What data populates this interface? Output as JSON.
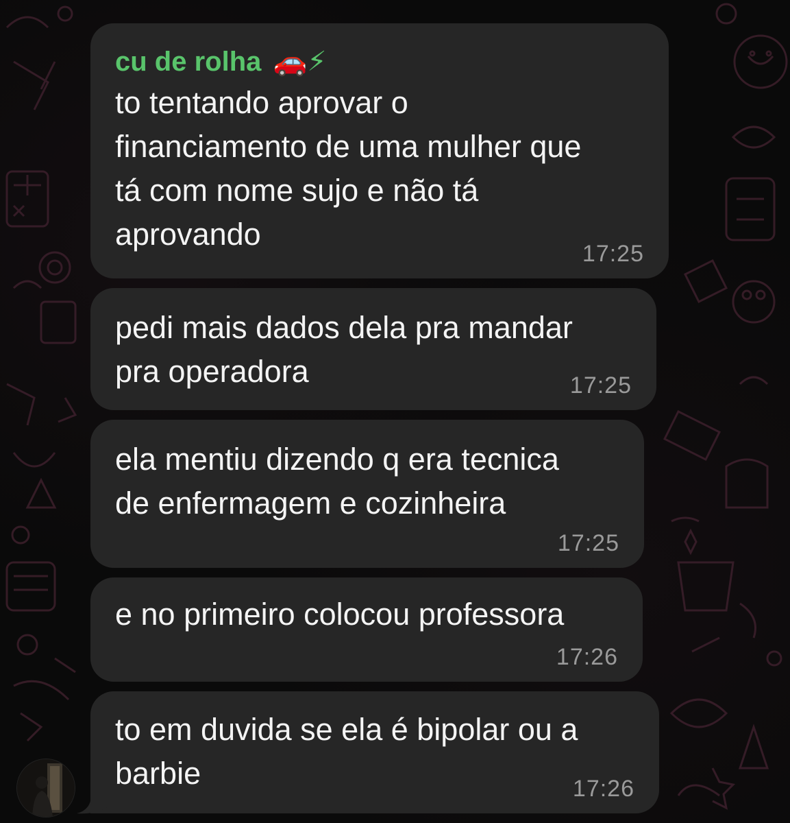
{
  "chat": {
    "sender": {
      "name": "cu de rolha",
      "emoji": "🚗⚡",
      "color": "#59c46b"
    },
    "messages": [
      {
        "text": "to tentando aprovar o\nfinanciamento de uma mulher que\ntá com nome sujo e não tá\naprovando",
        "time": "17:25"
      },
      {
        "text": "pedi mais dados dela pra mandar\npra operadora",
        "time": "17:25"
      },
      {
        "text": "ela mentiu dizendo q era tecnica\nde enfermagem e cozinheira",
        "time": "17:25"
      },
      {
        "text": "e no primeiro colocou professora",
        "time": "17:26"
      },
      {
        "text": "to em duvida se ela é bipolar ou a\nbarbie",
        "time": "17:26"
      }
    ],
    "colors": {
      "bubble": "#262626",
      "background": "#0a0a0a",
      "timestamp": "#9a9a9a",
      "wallpaper_doodle": "#3a1e2a"
    }
  }
}
